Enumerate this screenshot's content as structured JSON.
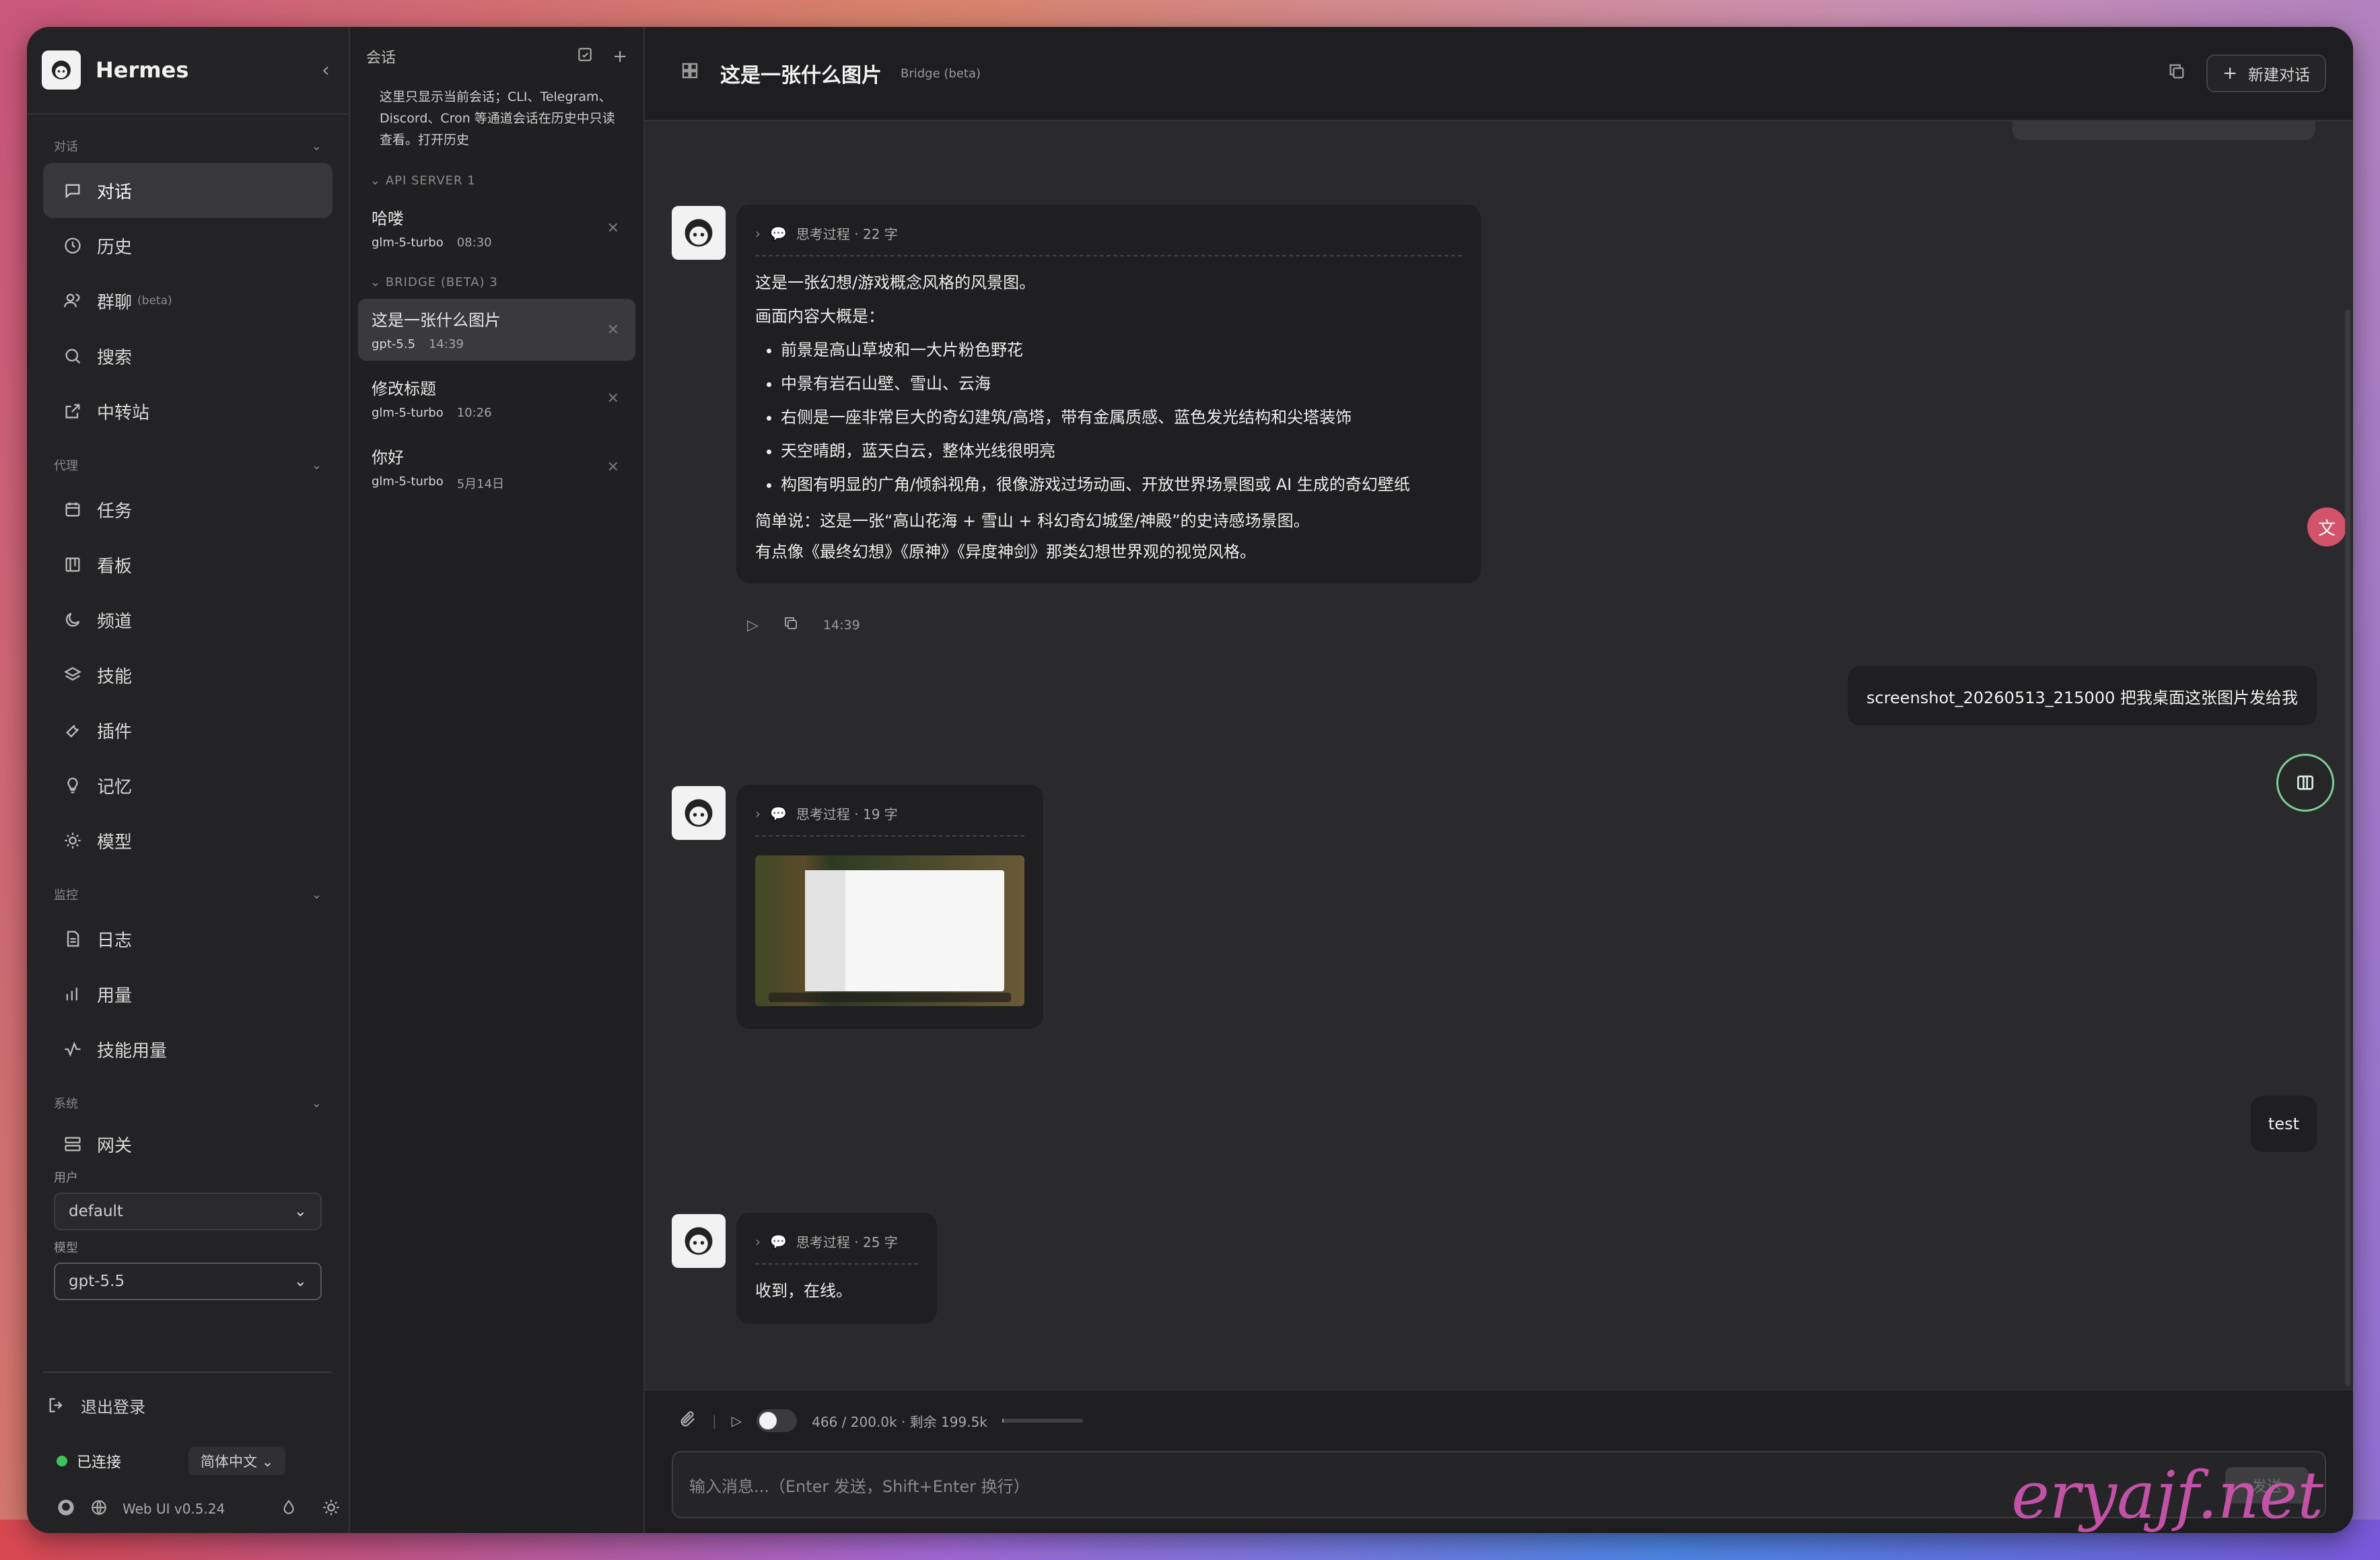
{
  "app": {
    "name": "Hermes"
  },
  "sidebar": {
    "sections": [
      {
        "title": "对话",
        "items": [
          {
            "label": "对话",
            "icon": "chat-icon",
            "active": true
          },
          {
            "label": "历史",
            "icon": "clock-icon"
          },
          {
            "label": "群聊",
            "icon": "users-icon",
            "tag": "(beta)"
          },
          {
            "label": "搜索",
            "icon": "search-icon"
          },
          {
            "label": "中转站",
            "icon": "external-link-icon"
          }
        ]
      },
      {
        "title": "代理",
        "items": [
          {
            "label": "任务",
            "icon": "calendar-icon"
          },
          {
            "label": "看板",
            "icon": "kanban-icon"
          },
          {
            "label": "频道",
            "icon": "moon-icon"
          },
          {
            "label": "技能",
            "icon": "layers-icon"
          },
          {
            "label": "插件",
            "icon": "wrench-icon"
          },
          {
            "label": "记忆",
            "icon": "lightbulb-icon"
          },
          {
            "label": "模型",
            "icon": "sun-icon"
          }
        ]
      },
      {
        "title": "监控",
        "items": [
          {
            "label": "日志",
            "icon": "file-icon"
          },
          {
            "label": "用量",
            "icon": "bar-chart-icon"
          },
          {
            "label": "技能用量",
            "icon": "activity-icon"
          }
        ]
      },
      {
        "title": "系统",
        "items": [
          {
            "label": "网关",
            "icon": "server-icon"
          }
        ]
      }
    ],
    "user_label": "用户",
    "user_value": "default",
    "model_label": "模型",
    "model_value": "gpt-5.5",
    "logout": "退出登录",
    "status": "已连接",
    "language": "简体中文",
    "version": "Web UI v0.5.24"
  },
  "conversations": {
    "header": "会话",
    "note": "这里只显示当前会话；CLI、Telegram、Discord、Cron 等通道会话在历史中只读查看。打开历史",
    "groups": [
      {
        "title": "API SERVER 1",
        "items": [
          {
            "title": "哈喽",
            "model": "glm-5-turbo",
            "time": "08:30"
          }
        ]
      },
      {
        "title": "BRIDGE (BETA) 3",
        "items": [
          {
            "title": "这是一张什么图片",
            "model": "gpt-5.5",
            "time": "14:39",
            "active": true
          },
          {
            "title": "修改标题",
            "model": "glm-5-turbo",
            "time": "10:26"
          },
          {
            "title": "你好",
            "model": "glm-5-turbo",
            "time": "5月14日"
          }
        ]
      }
    ]
  },
  "chat": {
    "title": "这是一张什么图片",
    "badge": "Bridge (beta)",
    "new_chat": "新建对话",
    "msg1": {
      "think": "思考过程 · 22 字",
      "intro": "这是一张幻想/游戏概念风格的风景图。",
      "subhead": "画面内容大概是：",
      "bullets": [
        "前景是高山草坡和一大片粉色野花",
        "中景有岩石山壁、雪山、云海",
        "右侧是一座非常巨大的奇幻建筑/高塔，带有金属质感、蓝色发光结构和尖塔装饰",
        "天空晴朗，蓝天白云，整体光线很明亮",
        "构图有明显的广角/倾斜视角，很像游戏过场动画、开放世界场景图或 AI 生成的奇幻壁纸"
      ],
      "summary1": "简单说：这是一张“高山花海 + 雪山 + 科幻奇幻城堡/神殿”的史诗感场景图。",
      "summary2": "有点像《最终幻想》《原神》《异度神剑》那类幻想世界观的视觉风格。",
      "time": "14:39"
    },
    "user1": "screenshot_20260513_215000 把我桌面这张图片发给我",
    "msg2": {
      "think": "思考过程 · 19 字"
    },
    "user2": "test",
    "msg3": {
      "think": "思考过程 · 25 字",
      "text": "收到，在线。"
    }
  },
  "composer": {
    "tokens": "466 / 200.0k · 剩余 199.5k",
    "token_fill": 0.0023,
    "placeholder": "输入消息...（Enter 发送，Shift+Enter 换行）",
    "send": "发送"
  },
  "watermark": "eryajf.net"
}
